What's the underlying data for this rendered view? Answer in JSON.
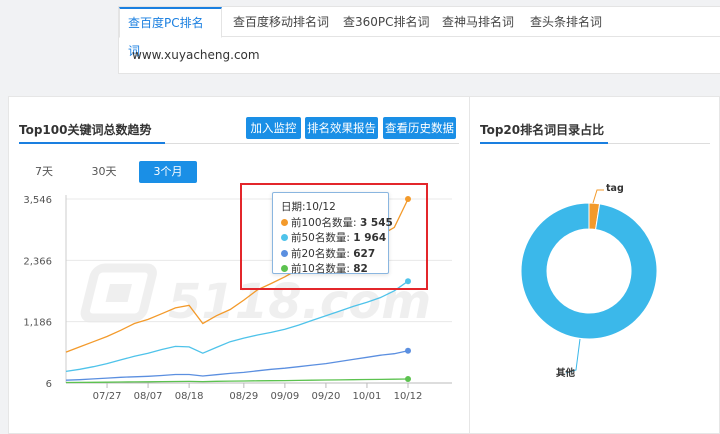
{
  "tabs": [
    {
      "label": "查百度PC排名词",
      "active": true
    },
    {
      "label": "查百度移动排名词",
      "active": false
    },
    {
      "label": "查360PC排名词",
      "active": false
    },
    {
      "label": "查神马排名词",
      "active": false
    },
    {
      "label": "查头条排名词",
      "active": false
    }
  ],
  "domain": "www.xuyacheng.com",
  "trend_panel": {
    "title": "Top100关键词总数趋势",
    "buttons": [
      "加入监控",
      "排名效果报告",
      "查看历史数据"
    ],
    "ranges": [
      {
        "label": "7天",
        "active": false
      },
      {
        "label": "30天",
        "active": false
      },
      {
        "label": "3个月",
        "active": true
      }
    ],
    "watermark": "5118.com"
  },
  "tooltip": {
    "date_label": "日期:10/12",
    "rows": [
      {
        "label": "前100名数量:",
        "value": "3 545",
        "color": "#f39a2b"
      },
      {
        "label": "前50名数量:",
        "value": "1 964",
        "color": "#4fc3ea"
      },
      {
        "label": "前20名数量:",
        "value": "627",
        "color": "#5b8fe0"
      },
      {
        "label": "前10名数量:",
        "value": "82",
        "color": "#5cc24f"
      }
    ]
  },
  "pie_panel": {
    "title": "Top20排名词目录占比"
  },
  "chart_data": [
    {
      "type": "line",
      "title": "Top100关键词总数趋势",
      "xlabel": "",
      "ylabel": "",
      "ylim": [
        6,
        3546
      ],
      "yticks": [
        "3,546",
        "2,366",
        "1,186",
        "6"
      ],
      "xticks": [
        "07/27",
        "08/07",
        "08/18",
        "08/29",
        "09/09",
        "09/20",
        "10/01",
        "10/12"
      ],
      "x": [
        "07/16",
        "07/20",
        "07/24",
        "07/27",
        "07/31",
        "08/04",
        "08/07",
        "08/11",
        "08/15",
        "08/18",
        "08/20",
        "08/22",
        "08/25",
        "08/29",
        "09/02",
        "09/05",
        "09/09",
        "09/13",
        "09/17",
        "09/20",
        "09/24",
        "09/28",
        "10/01",
        "10/04",
        "10/08",
        "10/12"
      ],
      "series": [
        {
          "name": "前100名数量",
          "color": "#f39a2b",
          "values": [
            600,
            700,
            800,
            900,
            1020,
            1150,
            1230,
            1340,
            1450,
            1500,
            1150,
            1300,
            1420,
            1600,
            1800,
            1920,
            2050,
            2200,
            2350,
            2450,
            2520,
            2600,
            2750,
            2850,
            3000,
            3545
          ]
        },
        {
          "name": "前50名数量",
          "color": "#4fc3ea",
          "values": [
            230,
            270,
            320,
            380,
            450,
            520,
            580,
            650,
            710,
            700,
            580,
            690,
            800,
            870,
            930,
            980,
            1040,
            1120,
            1210,
            1300,
            1390,
            1480,
            1560,
            1650,
            1780,
            1964
          ]
        },
        {
          "name": "前20名数量",
          "color": "#5b8fe0",
          "values": [
            60,
            70,
            85,
            100,
            115,
            125,
            135,
            150,
            170,
            170,
            140,
            165,
            190,
            210,
            240,
            270,
            290,
            320,
            350,
            380,
            420,
            460,
            500,
            540,
            570,
            627
          ]
        },
        {
          "name": "前10名数量",
          "color": "#5cc24f",
          "values": [
            15,
            18,
            20,
            22,
            25,
            27,
            30,
            32,
            35,
            36,
            33,
            38,
            42,
            45,
            48,
            50,
            53,
            56,
            60,
            63,
            66,
            70,
            73,
            76,
            79,
            82
          ]
        }
      ]
    },
    {
      "type": "pie",
      "title": "Top20排名词目录占比",
      "slices": [
        {
          "name": "tag",
          "value": 2.5,
          "color": "#f39a2b"
        },
        {
          "name": "其他",
          "value": 97.5,
          "color": "#3bb8ea"
        }
      ]
    }
  ]
}
